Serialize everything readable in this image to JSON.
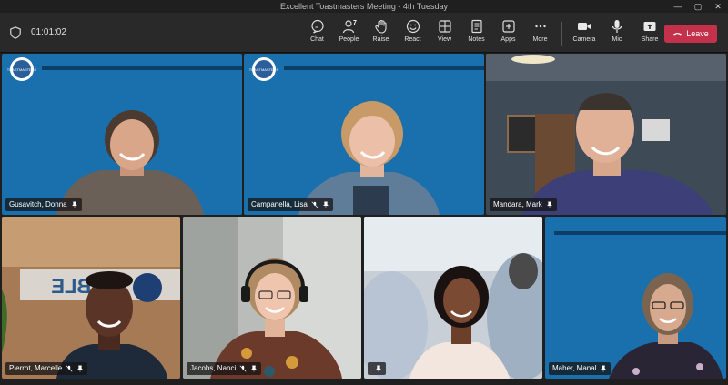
{
  "window": {
    "title": "Excellent Toastmasters Meeting - 4th Tuesday",
    "controls": [
      "—",
      "▢",
      "✕"
    ]
  },
  "toolbar": {
    "timer": "01:01:02",
    "people_count": "7",
    "items": [
      {
        "label": "Chat",
        "icon": "chat-icon"
      },
      {
        "label": "People",
        "icon": "people-icon"
      },
      {
        "label": "Raise",
        "icon": "hand-icon"
      },
      {
        "label": "React",
        "icon": "smile-icon"
      },
      {
        "label": "View",
        "icon": "grid-icon"
      },
      {
        "label": "Notes",
        "icon": "notes-icon"
      },
      {
        "label": "Apps",
        "icon": "plus-icon"
      },
      {
        "label": "More",
        "icon": "more-icon"
      }
    ],
    "devices": [
      {
        "label": "Camera",
        "icon": "camera-icon"
      },
      {
        "label": "Mic",
        "icon": "mic-icon"
      },
      {
        "label": "Share",
        "icon": "share-icon"
      }
    ],
    "leave_label": "Leave",
    "leave_color": "#c4314b"
  },
  "participants": [
    {
      "name": "Gusavitch, Donna",
      "muted": false
    },
    {
      "name": "Campanella, Lisa",
      "muted": true
    },
    {
      "name": "Mandara, Mark",
      "muted": false
    },
    {
      "name": "Pierrot, Marcelle",
      "muted": true
    },
    {
      "name": "Jacobs, Nanci",
      "muted": true
    },
    {
      "name": "",
      "muted": false
    },
    {
      "name": "Maher, Manal",
      "muted": false
    }
  ],
  "backgrounds": {
    "toastmasters_blue": "#1a6fad",
    "logo_text": "TOASTMASTERS",
    "wall_sign_text": "TABLE"
  }
}
